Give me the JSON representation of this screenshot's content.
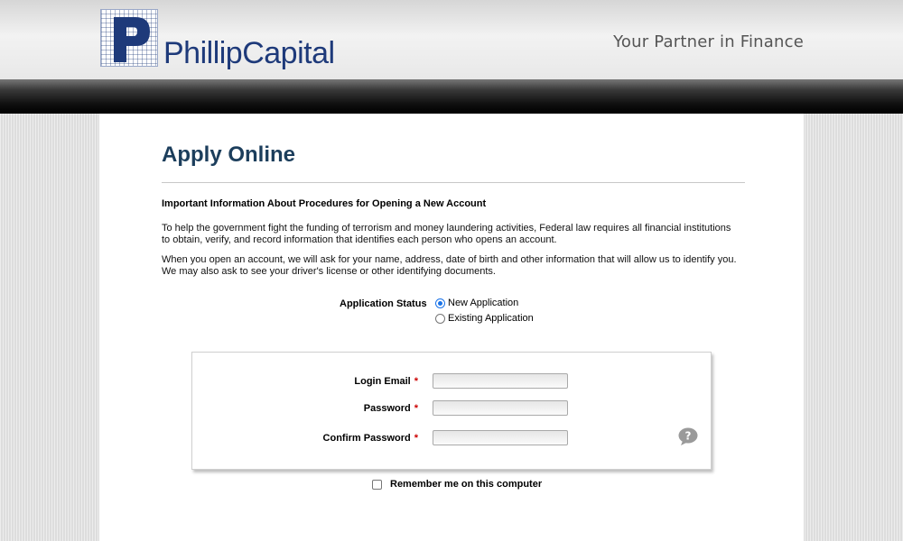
{
  "header": {
    "logo_text": "PhillipCapital",
    "tagline": "Your Partner in Finance",
    "logo_icon": "phillip-capital-p-logo",
    "brand_color": "#1e3a7a"
  },
  "page": {
    "title": "Apply Online",
    "important_heading": "Important Information About Procedures for Opening a New Account",
    "paragraph1": "To help the government fight the funding of terrorism and money laundering activities, Federal law requires all financial institutions to obtain, verify, and record information that identifies each person who opens an account.",
    "paragraph2": "When you open an account, we will ask for your name, address, date of birth and other information that will allow us to identify you. We may also ask to see your driver's license or other identifying documents."
  },
  "application_status": {
    "label": "Application Status",
    "options": [
      {
        "label": "New Application",
        "checked": true
      },
      {
        "label": "Existing Application",
        "checked": false
      }
    ]
  },
  "login_form": {
    "email_label": "Login Email",
    "password_label": "Password",
    "confirm_label": "Confirm Password",
    "required_marker": "*",
    "email_value": "",
    "password_value": "",
    "confirm_value": "",
    "help_icon": "question-mark-icon"
  },
  "remember": {
    "label": "Remember me on this computer",
    "checked": false
  }
}
